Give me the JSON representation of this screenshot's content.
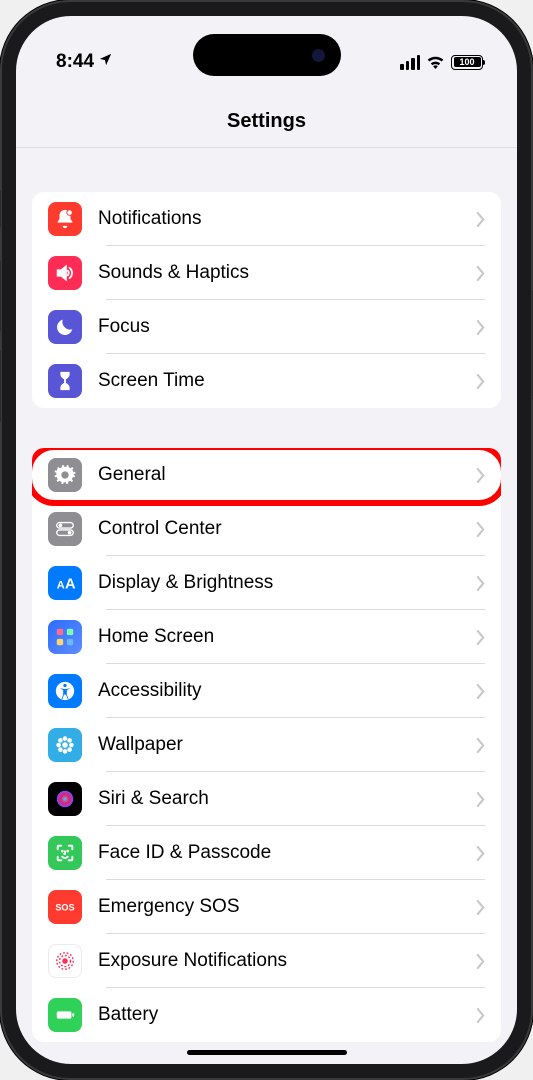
{
  "status": {
    "time": "8:44",
    "battery_pct": "100"
  },
  "header": {
    "title": "Settings"
  },
  "group1": [
    {
      "id": "notifications",
      "label": "Notifications",
      "icon": "bell-badge-icon",
      "bg": "bg-red"
    },
    {
      "id": "sounds-haptics",
      "label": "Sounds & Haptics",
      "icon": "speaker-icon",
      "bg": "bg-pink"
    },
    {
      "id": "focus",
      "label": "Focus",
      "icon": "moon-icon",
      "bg": "bg-indigo"
    },
    {
      "id": "screen-time",
      "label": "Screen Time",
      "icon": "hourglass-icon",
      "bg": "bg-indigo"
    }
  ],
  "group2": [
    {
      "id": "general",
      "label": "General",
      "icon": "gear-icon",
      "bg": "bg-gray",
      "highlighted": true
    },
    {
      "id": "control-center",
      "label": "Control Center",
      "icon": "switches-icon",
      "bg": "bg-gray"
    },
    {
      "id": "display-brightness",
      "label": "Display & Brightness",
      "icon": "text-size-icon",
      "bg": "bg-blue"
    },
    {
      "id": "home-screen",
      "label": "Home Screen",
      "icon": "grid-icon",
      "bg": "bg-home"
    },
    {
      "id": "accessibility",
      "label": "Accessibility",
      "icon": "accessibility-icon",
      "bg": "bg-blue"
    },
    {
      "id": "wallpaper",
      "label": "Wallpaper",
      "icon": "flower-icon",
      "bg": "bg-cyan"
    },
    {
      "id": "siri-search",
      "label": "Siri & Search",
      "icon": "siri-icon",
      "bg": "bg-black"
    },
    {
      "id": "face-id-passcode",
      "label": "Face ID & Passcode",
      "icon": "faceid-icon",
      "bg": "bg-green"
    },
    {
      "id": "emergency-sos",
      "label": "Emergency SOS",
      "icon": "sos-icon",
      "bg": "bg-red"
    },
    {
      "id": "exposure-notifications",
      "label": "Exposure Notifications",
      "icon": "exposure-icon",
      "bg": "bg-white"
    },
    {
      "id": "battery",
      "label": "Battery",
      "icon": "battery-icon",
      "bg": "bg-lgreen"
    }
  ]
}
